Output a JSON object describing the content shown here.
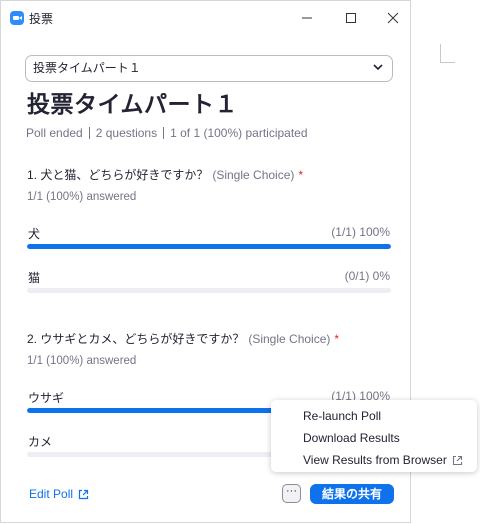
{
  "window": {
    "title": "投票"
  },
  "selector": {
    "value": "投票タイムパート１"
  },
  "poll": {
    "title": "投票タイムパート１",
    "status": "Poll ended",
    "question_count": "2 questions",
    "participation": "1 of 1 (100%) participated"
  },
  "questions": [
    {
      "text": "1. 犬と猫、どちらが好きですか？",
      "type": "(Single Choice)",
      "required_mark": "*",
      "answered": "1/1 (100%) answered",
      "options": [
        {
          "label": "犬",
          "value": "(1/1) 100%",
          "fraction": 1.0
        },
        {
          "label": "猫",
          "value": "(0/1) 0%",
          "fraction": 0.0
        }
      ]
    },
    {
      "text": "2. ウサギとカメ、どちらが好きですか？",
      "type": "(Single Choice)",
      "required_mark": "*",
      "answered": "1/1 (100%) answered",
      "options": [
        {
          "label": "ウサギ",
          "value": "(1/1) 100%",
          "fraction": 1.0
        },
        {
          "label": "カメ",
          "value": "",
          "fraction": 0.0
        }
      ]
    }
  ],
  "footer": {
    "edit_label": "Edit Poll",
    "more_label": "···",
    "share_label": "結果の共有"
  },
  "menu": {
    "items": [
      "Re-launch Poll",
      "Download Results",
      "View Results from Browser"
    ]
  },
  "colors": {
    "accent": "#0e72ed",
    "required": "#e02828",
    "muted": "#747487"
  }
}
